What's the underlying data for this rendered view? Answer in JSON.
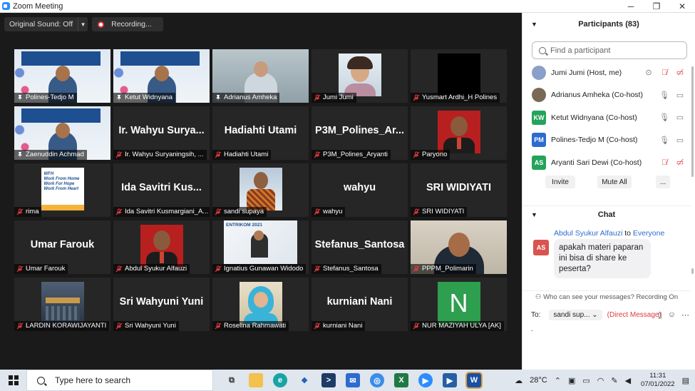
{
  "window": {
    "title": "Zoom Meeting",
    "controls": [
      "─",
      "❐",
      "✕"
    ]
  },
  "toolbar": {
    "original_sound": "Original Sound: Off",
    "recording": "Recording..."
  },
  "tiles": [
    {
      "name": "Polines-Tedjo M",
      "big": "",
      "kind": "slide",
      "active": true,
      "mic": "pin"
    },
    {
      "name": "Ketut Widnyana",
      "big": "",
      "kind": "slide",
      "active": false,
      "mic": "pin"
    },
    {
      "name": "Adrianus Amheka",
      "big": "",
      "kind": "office",
      "active": false,
      "mic": "pin"
    },
    {
      "name": "Jumi Jumi",
      "big": "",
      "kind": "photo-woman",
      "active": false,
      "mic": "muted"
    },
    {
      "name": "Yusmart Ardhi_H Polines",
      "big": "",
      "kind": "black",
      "active": false,
      "mic": "muted"
    },
    {
      "name": "Zaenuddin Achmad",
      "big": "",
      "kind": "slide",
      "active": false,
      "mic": "pin"
    },
    {
      "name": "Ir. Wahyu Suryaningsih, ...",
      "big": "Ir. Wahyu Surya...",
      "kind": "text",
      "active": false,
      "mic": "muted"
    },
    {
      "name": "Hadiahti Utami",
      "big": "Hadiahti Utami",
      "kind": "text",
      "active": false,
      "mic": "muted"
    },
    {
      "name": "P3M_Polines_Aryanti",
      "big": "P3M_Polines_Ar...",
      "kind": "text",
      "active": false,
      "mic": "muted"
    },
    {
      "name": "Paryono",
      "big": "",
      "kind": "photo-red",
      "active": false,
      "mic": "muted"
    },
    {
      "name": "rima",
      "big": "",
      "kind": "wfh",
      "active": false,
      "mic": "muted"
    },
    {
      "name": "Ida Savitri Kusmargiani_A...",
      "big": "Ida Savitri Kus...",
      "kind": "text",
      "active": false,
      "mic": "muted"
    },
    {
      "name": "sandi supaya",
      "big": "",
      "kind": "photo-batik",
      "active": false,
      "mic": "muted"
    },
    {
      "name": "wahyu",
      "big": "wahyu",
      "kind": "text",
      "active": false,
      "mic": "muted"
    },
    {
      "name": "SRI WIDIYATI",
      "big": "SRI WIDIYATI",
      "kind": "text",
      "active": false,
      "mic": "muted"
    },
    {
      "name": "Umar Farouk",
      "big": "Umar Farouk",
      "kind": "text",
      "active": false,
      "mic": "muted"
    },
    {
      "name": "Abdul Syukur Alfauzi",
      "big": "",
      "kind": "photo-red",
      "active": false,
      "mic": "muted"
    },
    {
      "name": "Ignatius Gunawan Widodo",
      "big": "",
      "kind": "poster",
      "active": false,
      "mic": "muted"
    },
    {
      "name": "Stefanus_Santosa",
      "big": "Stefanus_Santosa",
      "kind": "text",
      "active": false,
      "mic": "muted"
    },
    {
      "name": "PPPM_Polimarin",
      "big": "",
      "kind": "video-man",
      "active": false,
      "mic": "muted"
    },
    {
      "name": "LARDIN KORAWIJAYANTI",
      "big": "",
      "kind": "building",
      "active": false,
      "mic": "muted"
    },
    {
      "name": "Sri Wahyuni Yuni",
      "big": "Sri Wahyuni Yuni",
      "kind": "text",
      "active": false,
      "mic": "muted"
    },
    {
      "name": "Roselina Rahmawati",
      "big": "",
      "kind": "photo-hijab",
      "active": false,
      "mic": "muted"
    },
    {
      "name": "kurniani Nani",
      "big": "kurniani Nani",
      "kind": "text",
      "active": false,
      "mic": "muted"
    },
    {
      "name": "NUR MAZIYAH ULYA [AK]",
      "big": "",
      "kind": "letter-n",
      "active": false,
      "mic": "muted"
    }
  ],
  "wfh_text": [
    "WFH",
    "Work From Home",
    "Work For Hope",
    "Work From Heart"
  ],
  "poster_text": "ENTRIKOM 2021",
  "letter_n": "N",
  "participants": {
    "title": "Participants (83)",
    "search_placeholder": "Find a participant",
    "list": [
      {
        "name": "Jumi Jumi (Host, me)",
        "initials": "",
        "color": "#8aa0c8"
      },
      {
        "name": "Adrianus Amheka (Co-host)",
        "initials": "",
        "color": "#7a6a55"
      },
      {
        "name": "Ketut Widnyana (Co-host)",
        "initials": "KW",
        "color": "#23a45a"
      },
      {
        "name": "Polines-Tedjo M (Co-host)",
        "initials": "PM",
        "color": "#2d6bcf"
      },
      {
        "name": "Aryanti Sari Dewi (Co-host)",
        "initials": "AS",
        "color": "#23a45a"
      }
    ],
    "invite": "Invite",
    "mute_all": "Mute All",
    "more": "..."
  },
  "chat": {
    "title": "Chat",
    "sender": "Abdul Syukur Alfauzi",
    "to_word": "to",
    "recipient": "Everyone",
    "sender_initials": "AS",
    "message": "apakah materi paparan ini bisa di share ke peserta?",
    "visibility": "Who can see your messages? Recording On",
    "to_label": "To:",
    "to_select": "sandi sup...",
    "dm": "(Direct Message)"
  },
  "taskbar": {
    "search_placeholder": "Type here to search",
    "temperature": "28°C",
    "time": "11:31",
    "date": "07/01/2022",
    "apps": [
      "task-view",
      "file-explorer",
      "edge",
      "dropbox",
      "powershell",
      "mail",
      "chrome",
      "excel",
      "zoom",
      "media",
      "word"
    ]
  },
  "colors": {
    "active_speaker": "#e8e84a",
    "muted": "#e0393e",
    "link": "#2d6bcf"
  }
}
